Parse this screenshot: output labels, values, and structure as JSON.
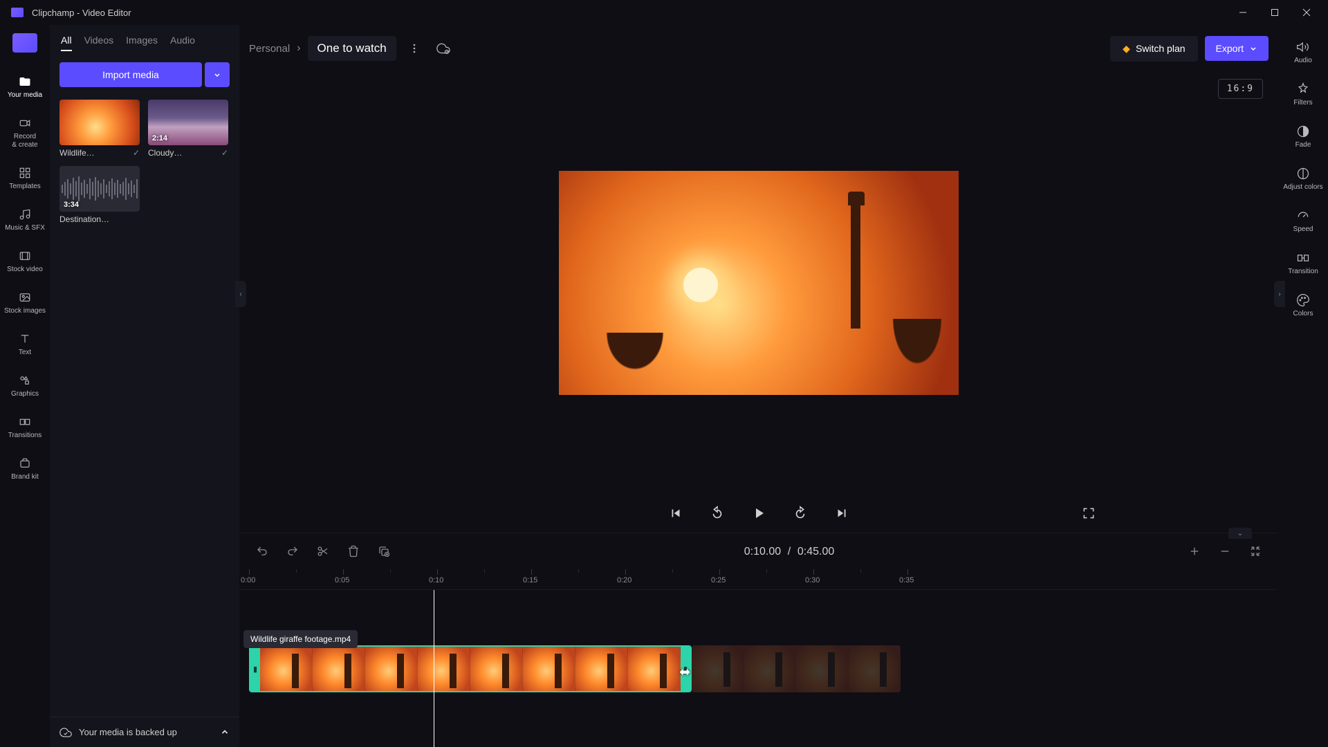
{
  "app": {
    "title": "Clipchamp - Video Editor"
  },
  "rail": {
    "items": [
      {
        "label": "Your media"
      },
      {
        "label": "Record\n& create"
      },
      {
        "label": "Templates"
      },
      {
        "label": "Music & SFX"
      },
      {
        "label": "Stock video"
      },
      {
        "label": "Stock images"
      },
      {
        "label": "Text"
      },
      {
        "label": "Graphics"
      },
      {
        "label": "Transitions"
      },
      {
        "label": "Brand kit"
      }
    ]
  },
  "media": {
    "tabs": [
      "All",
      "Videos",
      "Images",
      "Audio"
    ],
    "import_label": "Import media",
    "items": [
      {
        "name": "Wildlife…",
        "duration": ""
      },
      {
        "name": "Cloudy…",
        "duration": "2:14"
      },
      {
        "name": "Destination…",
        "duration": "3:34"
      }
    ],
    "backup_text": "Your media is backed up"
  },
  "topbar": {
    "breadcrumb": "Personal",
    "project_title": "One to watch",
    "switch_plan": "Switch plan",
    "export": "Export",
    "aspect": "16:9"
  },
  "playback": {
    "current": "0:10.00",
    "sep": "/",
    "total": "0:45.00"
  },
  "ruler": {
    "ticks": [
      "0:00",
      "0:05",
      "0:10",
      "0:15",
      "0:20",
      "0:25",
      "0:30",
      "0:35"
    ]
  },
  "clip": {
    "tooltip": "Wildlife giraffe footage.mp4"
  },
  "right_rail": {
    "items": [
      {
        "label": "Audio"
      },
      {
        "label": "Filters"
      },
      {
        "label": "Fade"
      },
      {
        "label": "Adjust colors"
      },
      {
        "label": "Speed"
      },
      {
        "label": "Transition"
      },
      {
        "label": "Colors"
      }
    ]
  }
}
